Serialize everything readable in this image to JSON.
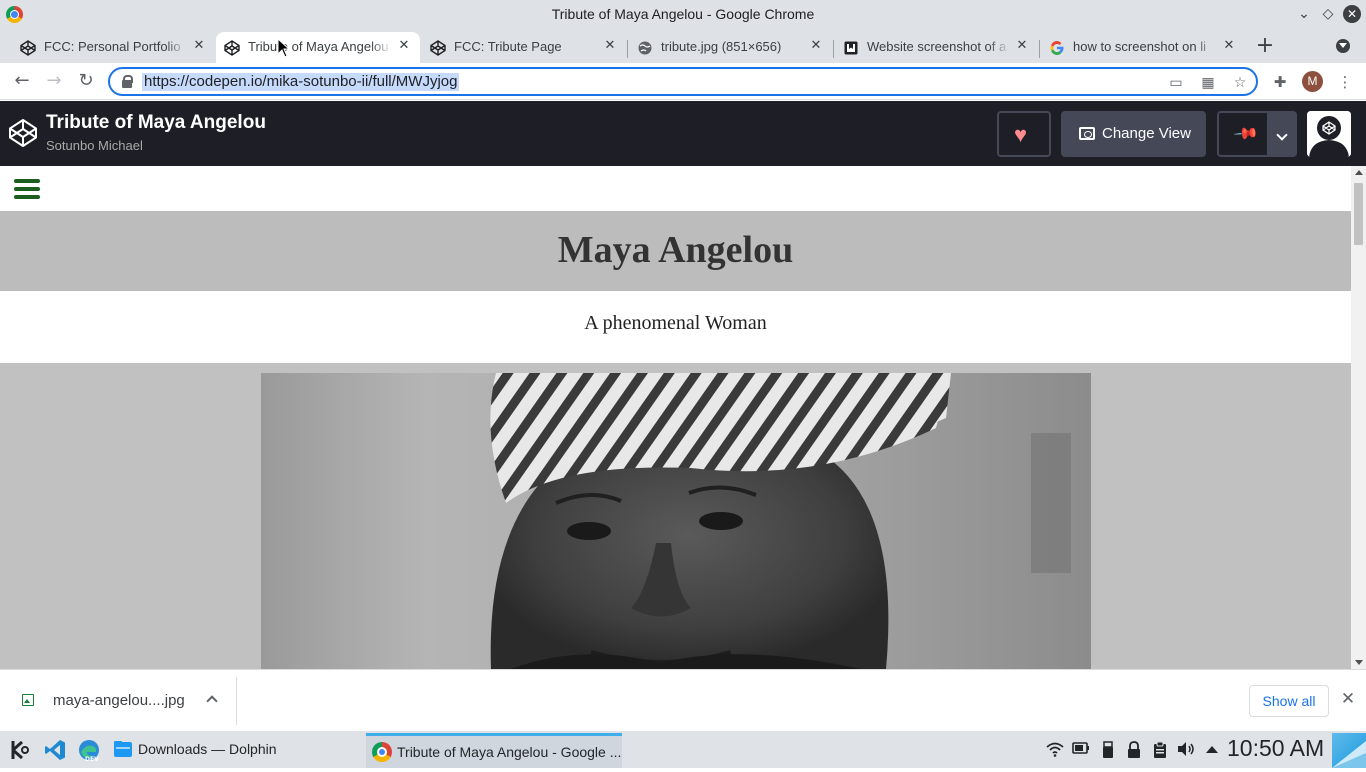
{
  "window": {
    "title": "Tribute of Maya Angelou - Google Chrome"
  },
  "tabs": [
    {
      "label": "FCC: Personal Portfolio",
      "icon": "codepen-icon"
    },
    {
      "label": "Tribute of Maya Angelou",
      "icon": "codepen-icon",
      "active": true
    },
    {
      "label": "FCC: Tribute Page",
      "icon": "codepen-icon"
    },
    {
      "label": "tribute.jpg (851×656)",
      "icon": "globe-icon"
    },
    {
      "label": "Website screenshot of a",
      "icon": "bookmark-icon"
    },
    {
      "label": "how to screenshot on li",
      "icon": "google-icon"
    }
  ],
  "address_bar": {
    "url": "https://codepen.io/mika-sotunbo-ii/full/MWJyjog"
  },
  "profile": {
    "initial": "M"
  },
  "codepen": {
    "pen_title": "Tribute of Maya Angelou",
    "author": "Sotunbo Michael",
    "change_view_label": "Change View"
  },
  "page": {
    "heading": "Maya Angelou",
    "subheading": "A phenomenal Woman"
  },
  "downloads": {
    "file_name": "maya-angelou....jpg",
    "show_all_label": "Show all"
  },
  "taskbar": {
    "tasks": [
      {
        "label": "Downloads — Dolphin"
      },
      {
        "label": "Tribute of Maya Angelou - Google ..."
      }
    ],
    "clock": "10:50 AM"
  },
  "colors": {
    "accent": "#1a73e8",
    "codepen_header": "#1e1f26",
    "hamburger": "#1a5e20",
    "hero_band": "#bcbcbc",
    "heart": "#ff8c8c"
  }
}
